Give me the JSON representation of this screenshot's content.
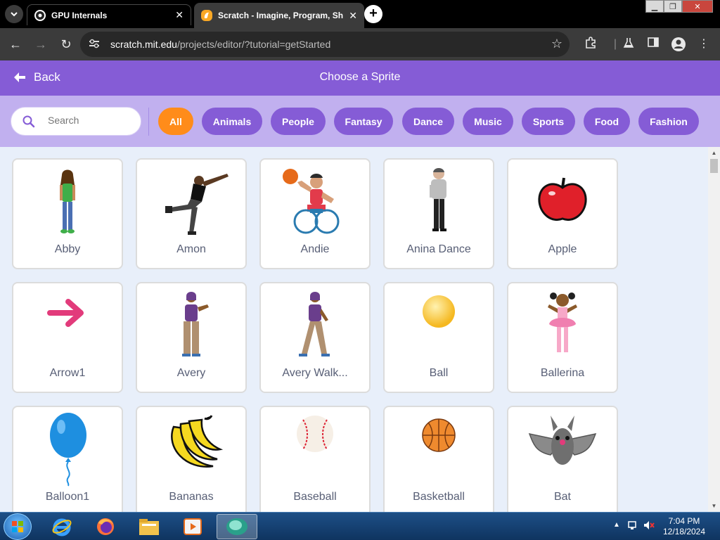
{
  "browser": {
    "tabs": [
      {
        "title": "GPU Internals",
        "icon": "chrome-icon",
        "active": false
      },
      {
        "title": "Scratch - Imagine, Program, Sh",
        "icon": "scratch-icon",
        "active": true
      }
    ],
    "url_host": "scratch.mit.edu",
    "url_path": "/projects/editor/?tutorial=getStarted"
  },
  "header": {
    "back_label": "Back",
    "title": "Choose a Sprite"
  },
  "search": {
    "placeholder": "Search"
  },
  "categories": [
    "All",
    "Animals",
    "People",
    "Fantasy",
    "Dance",
    "Music",
    "Sports",
    "Food",
    "Fashion"
  ],
  "active_category": "All",
  "sprites": [
    {
      "name": "Abby"
    },
    {
      "name": "Amon"
    },
    {
      "name": "Andie"
    },
    {
      "name": "Anina Dance"
    },
    {
      "name": "Apple"
    },
    {
      "name": "Arrow1"
    },
    {
      "name": "Avery"
    },
    {
      "name": "Avery Walk..."
    },
    {
      "name": "Ball"
    },
    {
      "name": "Ballerina"
    },
    {
      "name": "Balloon1"
    },
    {
      "name": "Bananas"
    },
    {
      "name": "Baseball"
    },
    {
      "name": "Basketball"
    },
    {
      "name": "Bat"
    }
  ],
  "taskbar": {
    "time": "7:04 PM",
    "date": "12/18/2024"
  },
  "colors": {
    "scratch_purple": "#855cd6",
    "filter_bg": "#c1b0ef",
    "active_chip": "#ff8c1a"
  }
}
